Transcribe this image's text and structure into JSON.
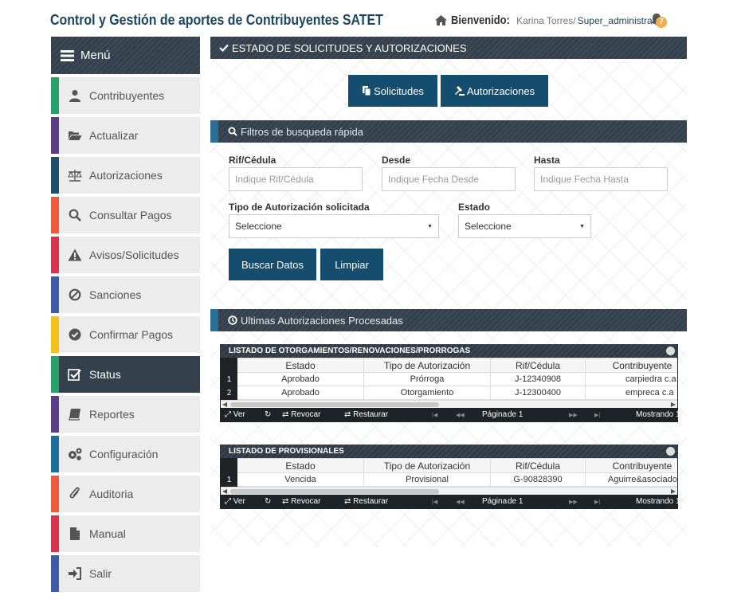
{
  "header": {
    "title": "Control y Gestión de aportes de Contribuyentes SATET",
    "welcome_label": "Bienvenido:",
    "user_name": "Karina Torres/",
    "user_role": "Super_administrador",
    "notification_count": "7"
  },
  "sidebar": {
    "menu_label": "Menú",
    "items": [
      {
        "label": "Contribuyentes",
        "icon": "user-icon",
        "color": "#27a06a"
      },
      {
        "label": "Actualizar",
        "icon": "folder-open-icon",
        "color": "#5b3f86"
      },
      {
        "label": "Autorizaciones",
        "icon": "balance-scale-icon",
        "color": "#1b4f6b"
      },
      {
        "label": "Consultar Pagos",
        "icon": "search-icon",
        "color": "#f05a3c"
      },
      {
        "label": "Avisos/Solicitudes",
        "icon": "warning-icon",
        "color": "#d8344f"
      },
      {
        "label": "Sanciones",
        "icon": "ban-icon",
        "color": "#3f5aa6"
      },
      {
        "label": "Confirmar Pagos",
        "icon": "check-circle-icon",
        "color": "#f3c11a"
      },
      {
        "label": "Status",
        "icon": "checkbox-icon",
        "color": "#27a06a"
      },
      {
        "label": "Reportes",
        "icon": "book-icon",
        "color": "#5b3f86"
      },
      {
        "label": "Configuración",
        "icon": "cogs-icon",
        "color": "#1b6f9a"
      },
      {
        "label": "Auditoria",
        "icon": "paperclip-icon",
        "color": "#f05a3c"
      },
      {
        "label": "Manual",
        "icon": "file-icon",
        "color": "#d8344f"
      },
      {
        "label": "Salir",
        "icon": "sign-in-icon",
        "color": "#3f5aa6"
      }
    ]
  },
  "main": {
    "title": "ESTADO DE SOLICITUDES Y AUTORIZACIONES",
    "tab_solicitudes": "Solicitudes",
    "tab_autorizaciones": "Autorizaciones",
    "filters_title": "Filtros de busqueda rápida",
    "rif_label": "Rif/Cédula",
    "rif_placeholder": "Indique Rif/Cédula",
    "desde_label": "Desde",
    "desde_placeholder": "Indique Fecha Desde",
    "hasta_label": "Hasta",
    "hasta_placeholder": "Indique Fecha Hasta",
    "tipo_label": "Tipo de Autorización solicitada",
    "tipo_value": "Seleccione",
    "estado_label": "Estado",
    "estado_value": "Seleccione",
    "buscar_button": "Buscar Datos",
    "limpiar_button": "Limpiar",
    "recent_title": "Ultimas Autorizaciones Procesadas"
  },
  "grid1": {
    "caption": "LISTADO DE OTORGAMIENTOS/RENOVACIONES/PRORROGAS",
    "columns": [
      "Estado",
      "Tipo de Autorización",
      "Rif/Cédula",
      "Contribuyente"
    ],
    "rows": [
      {
        "n": "1",
        "estado": "Aprobado",
        "tipo": "Prórroga",
        "rif": "J-12340908",
        "contribuyente": "carpiedra c.a"
      },
      {
        "n": "2",
        "estado": "Aprobado",
        "tipo": "Otorgamiento",
        "rif": "J-12300400",
        "contribuyente": "empreca c.a"
      }
    ],
    "ver": "Ver",
    "revocar": "Revocar",
    "restaurar": "Restaurar",
    "pagina": "Página",
    "de": "de 1",
    "mostrando": "Mostrando 1"
  },
  "grid2": {
    "caption": "LISTADO DE PROVISIONALES",
    "columns": [
      "Estado",
      "Tipo de Autorización",
      "Rif/Cédula",
      "Contribuyente"
    ],
    "rows": [
      {
        "n": "1",
        "estado": "Vencida",
        "tipo": "Provisional",
        "rif": "G-90828390",
        "contribuyente": "Aguirre&asociados"
      }
    ],
    "ver": "Ver",
    "revocar": "Revocar",
    "restaurar": "Restaurar",
    "pagina": "Página",
    "de": "de 1",
    "mostrando": "Mostrando 1"
  }
}
